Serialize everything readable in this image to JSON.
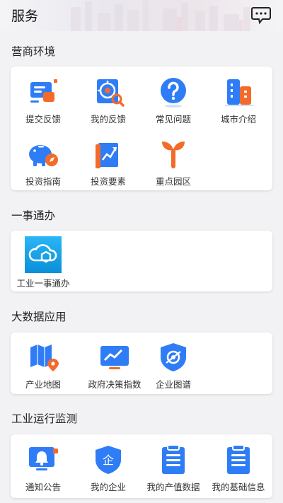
{
  "header": {
    "title": "服务",
    "message_icon": "chat-bubble-icon"
  },
  "sections": [
    {
      "title": "营商环境",
      "items": [
        {
          "label": "提交反馈",
          "icon": "feedback-submit-icon"
        },
        {
          "label": "我的反馈",
          "icon": "target-search-icon"
        },
        {
          "label": "常见问题",
          "icon": "question-icon"
        },
        {
          "label": "城市介绍",
          "icon": "city-buildings-icon"
        },
        {
          "label": "投资指南",
          "icon": "piggy-bank-compass-icon"
        },
        {
          "label": "投资要素",
          "icon": "book-chart-icon"
        },
        {
          "label": "重点园区",
          "icon": "sprout-icon"
        }
      ]
    },
    {
      "title": "一事通办",
      "items": [
        {
          "label": "工业一事通办",
          "icon": "cloud-app-icon"
        }
      ]
    },
    {
      "title": "大数据应用",
      "items": [
        {
          "label": "产业地图",
          "icon": "map-pin-icon"
        },
        {
          "label": "政府决策指数",
          "icon": "monitor-chart-icon"
        },
        {
          "label": "企业图谱",
          "icon": "shield-graph-icon"
        }
      ]
    },
    {
      "title": "工业运行监测",
      "items": [
        {
          "label": "通知公告",
          "icon": "bell-icon"
        },
        {
          "label": "我的企业",
          "icon": "enterprise-shield-icon"
        },
        {
          "label": "我的产值数据",
          "icon": "clipboard-list-icon"
        },
        {
          "label": "我的基础信息",
          "icon": "clipboard-info-icon"
        }
      ]
    }
  ],
  "colors": {
    "blue": "#2f7df6",
    "blue_light": "#5aa6ff",
    "orange": "#f26b2a",
    "teal": "#1ea0e8"
  }
}
